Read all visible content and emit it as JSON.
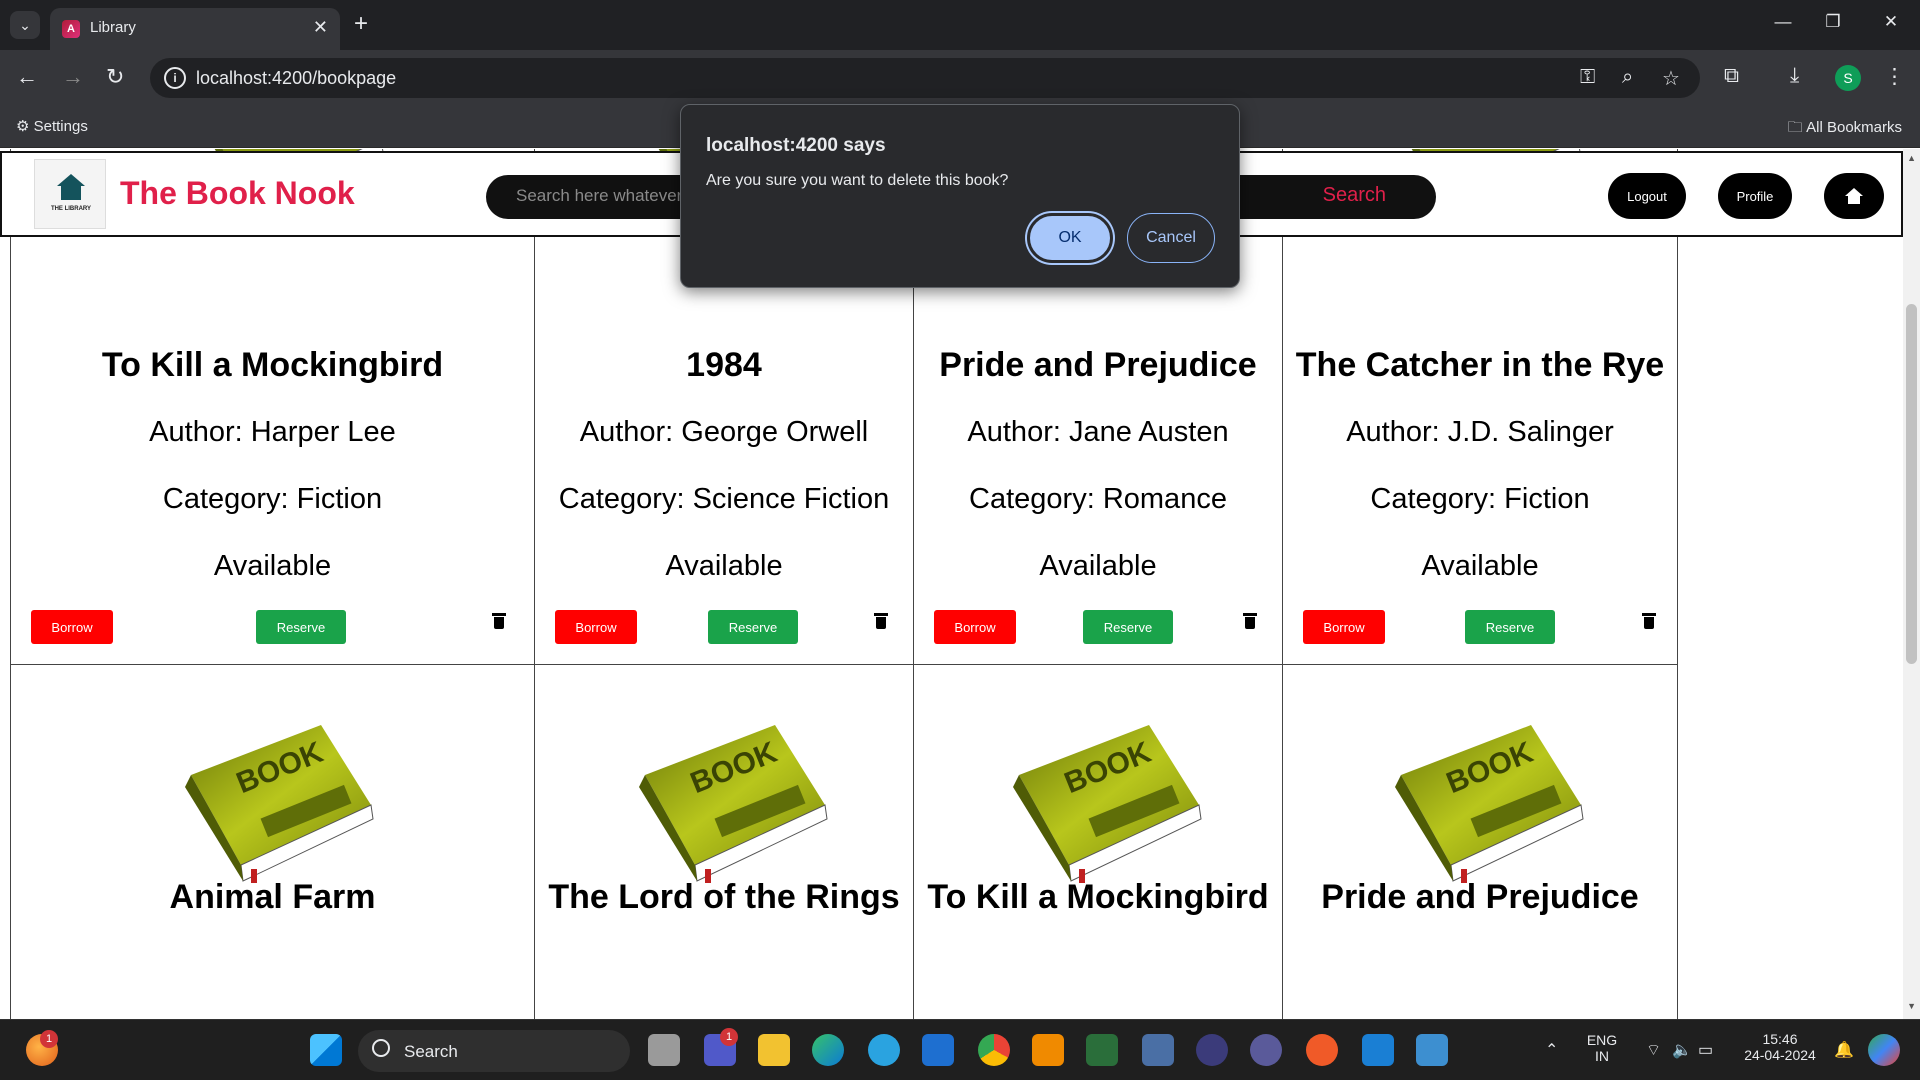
{
  "browser": {
    "tab_title": "Library",
    "url": "localhost:4200/bookpage",
    "profile_initial": "S",
    "bookmarks_settings": "Settings",
    "bookmarks_all": "All Bookmarks"
  },
  "navbar": {
    "brand": "The Book Nook",
    "logo_text": "THE LIBRARY",
    "search_placeholder": "Search  here whatever",
    "search_button": "Search",
    "logout": "Logout",
    "profile": "Profile"
  },
  "books_row1": [
    {
      "title": "To Kill a Mockingbird",
      "author": "Author: Harper Lee",
      "category": "Category: Fiction",
      "status": "Available"
    },
    {
      "title": "1984",
      "author": "Author: George Orwell",
      "category": "Category: Science Fiction",
      "status": "Available"
    },
    {
      "title": "Pride and Prejudice",
      "author": "Author: Jane Austen",
      "category": "Category: Romance",
      "status": "Available"
    },
    {
      "title": "The Catcher in the Rye",
      "author": "Author: J.D. Salinger",
      "category": "Category: Fiction",
      "status": "Available"
    }
  ],
  "books_row2": [
    {
      "title": "Animal Farm"
    },
    {
      "title": "The Lord of the Rings"
    },
    {
      "title": "To Kill a Mockingbird"
    },
    {
      "title": "Pride and Prejudice"
    }
  ],
  "buttons": {
    "borrow": "Borrow",
    "reserve": "Reserve",
    "book_word": "BOOK"
  },
  "dialog": {
    "title": "localhost:4200 says",
    "message": "Are you sure you want to delete this book?",
    "ok": "OK",
    "cancel": "Cancel"
  },
  "taskbar": {
    "search": "Search",
    "lang1": "ENG",
    "lang2": "IN",
    "time": "15:46",
    "date": "24-04-2024",
    "notif_count": "1",
    "teams_count": "1"
  }
}
